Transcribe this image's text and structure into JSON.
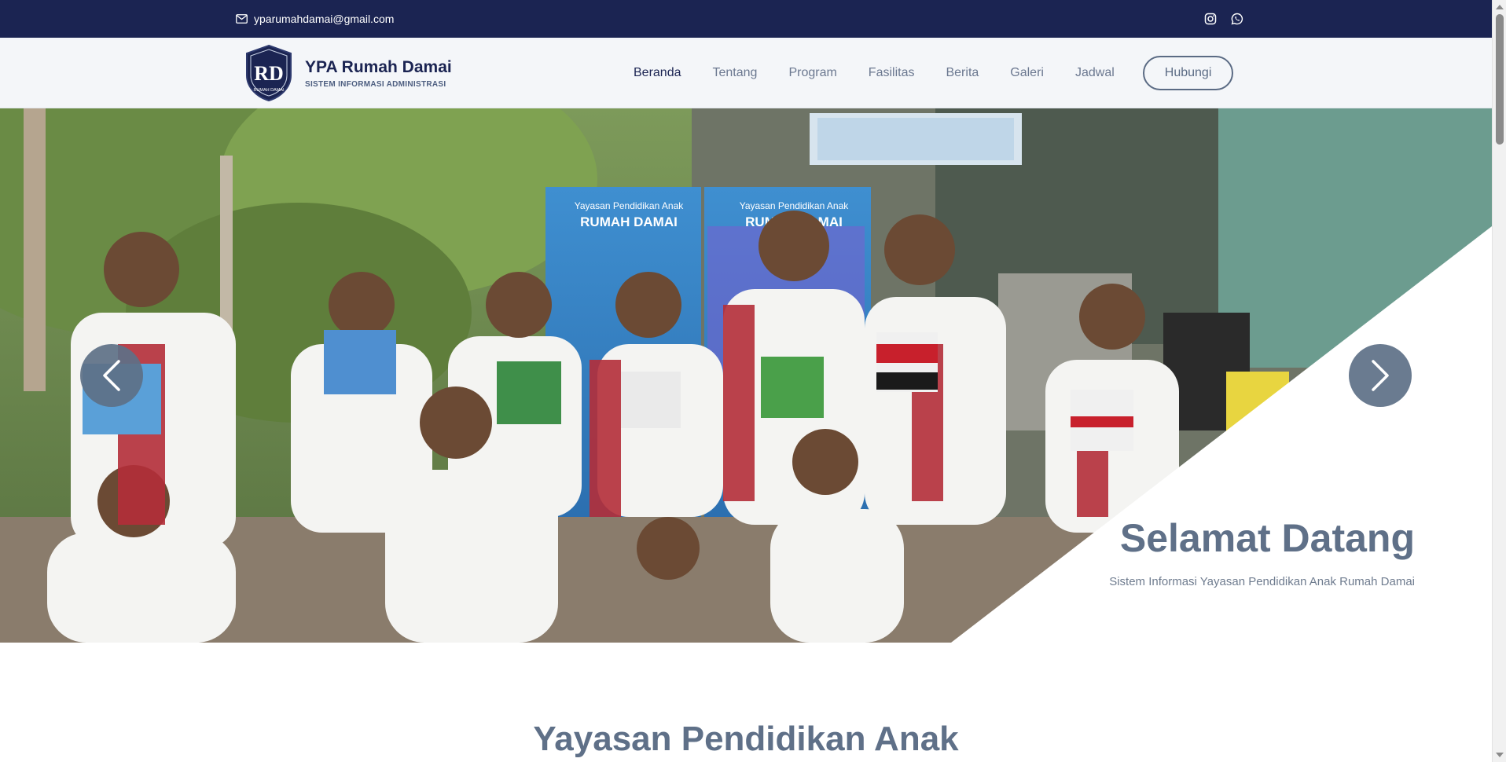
{
  "topbar": {
    "email": "yparumahdamai@gmail.com",
    "email_icon": "mail-icon",
    "socials": [
      {
        "icon": "instagram-icon"
      },
      {
        "icon": "whatsapp-icon"
      }
    ]
  },
  "brand": {
    "name": "YPA Rumah Damai",
    "tagline": "SISTEM INFORMASI ADMINISTRASI",
    "logo_initials": "RD",
    "logo_text": "RUMAH DAMAI"
  },
  "nav": {
    "items": [
      "Beranda",
      "Tentang",
      "Program",
      "Fasilitas",
      "Berita",
      "Galeri",
      "Jadwal"
    ],
    "active": "Beranda",
    "contact_label": "Hubungi"
  },
  "hero": {
    "title": "Selamat Datang",
    "subtitle": "Sistem Informasi Yayasan Pendidikan Anak Rumah Damai",
    "prev_icon": "chevron-left-icon",
    "next_icon": "chevron-right-icon",
    "banner_heading": "Yayasan Pendidikan Anak",
    "banner_name": "RUMAH DAMAI"
  },
  "section": {
    "title": "Yayasan Pendidikan Anak"
  },
  "colors": {
    "topbar_bg": "#1b2452",
    "header_bg": "#f4f6f9",
    "accent_slate": "#5f7088",
    "nav_text": "#6b7890"
  }
}
